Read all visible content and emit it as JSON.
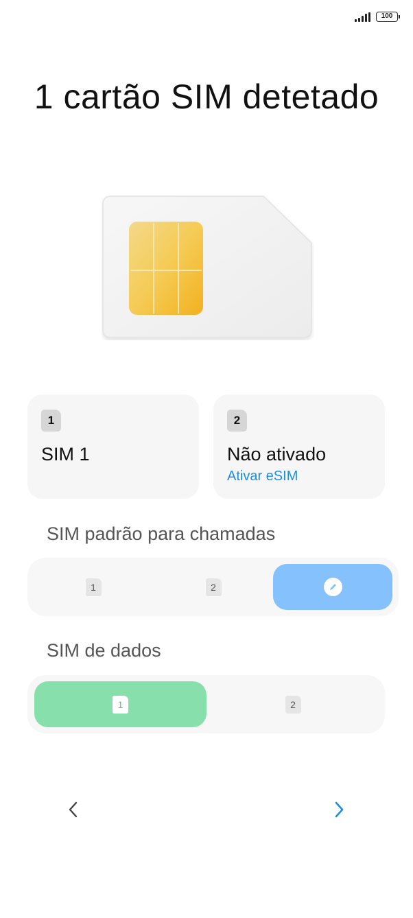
{
  "status_bar": {
    "battery_level": "100",
    "signal_icon": "signal-bars-icon",
    "battery_icon": "battery-icon"
  },
  "title": "1 cartão SIM detetado",
  "sim_cards": [
    {
      "slot": "1",
      "name": "SIM 1",
      "link": ""
    },
    {
      "slot": "2",
      "name": "Não ativado",
      "link": "Ativar eSIM"
    }
  ],
  "calls_section": {
    "label": "SIM padrão para chamadas",
    "options": [
      "1",
      "2"
    ],
    "selected_icon": "edit-pencil-icon",
    "selected_color": "#85c1fc"
  },
  "data_section": {
    "label": "SIM de dados",
    "options": [
      "1",
      "2"
    ],
    "selected": "1",
    "selected_color": "#87e0ac"
  },
  "navigation": {
    "back_icon": "chevron-left-icon",
    "next_icon": "chevron-right-icon",
    "accent": "#1c8fe3"
  }
}
